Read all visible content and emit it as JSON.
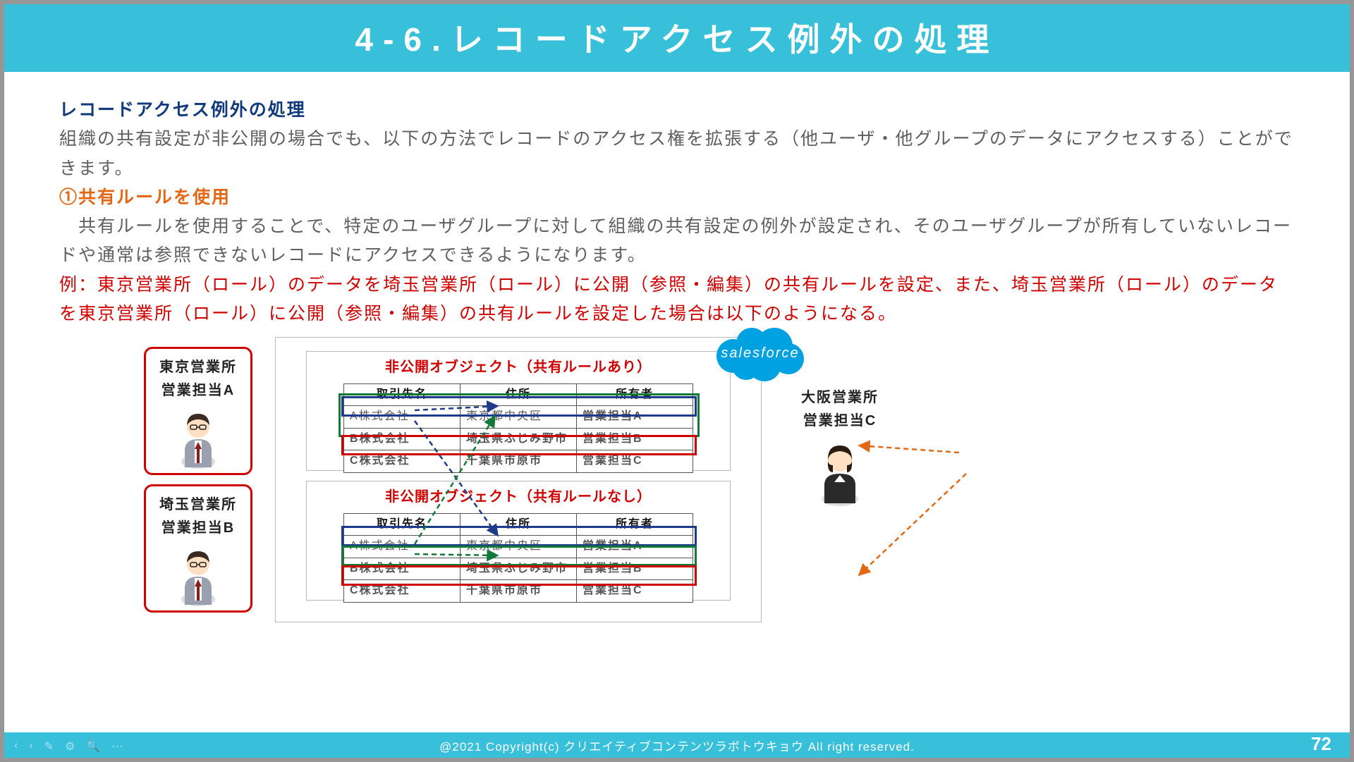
{
  "title": "4-6.レコードアクセス例外の処理",
  "section_heading": "レコードアクセス例外の処理",
  "intro_text": "組織の共有設定が非公開の場合でも、以下の方法でレコードのアクセス権を拡張する（他ユーザ・他グループのデータにアクセスする）ことができます。",
  "rule_title": "①共有ルールを使用",
  "rule_body": "　共有ルールを使用することで、特定のユーザグループに対して組織の共有設定の例外が設定され、そのユーザグループが所有していないレコードや通常は参照できないレコードにアクセスできるようになります。",
  "example_text": "例：東京営業所（ロール）のデータを埼玉営業所（ロール）に公開（参照・編集）の共有ルールを設定、また、埼玉営業所（ロール）のデータを東京営業所（ロール）に公開（参照・編集）の共有ルールを設定した場合は以下のようになる。",
  "users": {
    "a": {
      "line1": "東京営業所",
      "line2": "営業担当A"
    },
    "b": {
      "line1": "埼玉営業所",
      "line2": "営業担当B"
    },
    "c": {
      "line1": "大阪営業所",
      "line2": "営業担当C"
    }
  },
  "table_headers": [
    "取引先名",
    "住所",
    "所有者"
  ],
  "table1": {
    "title": "非公開オブジェクト（共有ルールあり）",
    "rows": [
      [
        "A株式会社",
        "東京都中央区",
        "営業担当A"
      ],
      [
        "B株式会社",
        "埼玉県ふじみ野市",
        "営業担当B"
      ],
      [
        "C株式会社",
        "千葉県市原市",
        "営業担当C"
      ]
    ]
  },
  "table2": {
    "title": "非公開オブジェクト（共有ルールなし）",
    "rows": [
      [
        "A株式会社",
        "東京都中央区",
        "営業担当A"
      ],
      [
        "B株式会社",
        "埼玉県ふじみ野市",
        "営業担当B"
      ],
      [
        "C株式会社",
        "千葉県市原市",
        "営業担当C"
      ]
    ]
  },
  "cloud_label": "salesforce",
  "footer_text": "@2021 Copyright(c) クリエイティブコンテンツラボトウキョウ All right reserved.",
  "page_number": "72"
}
